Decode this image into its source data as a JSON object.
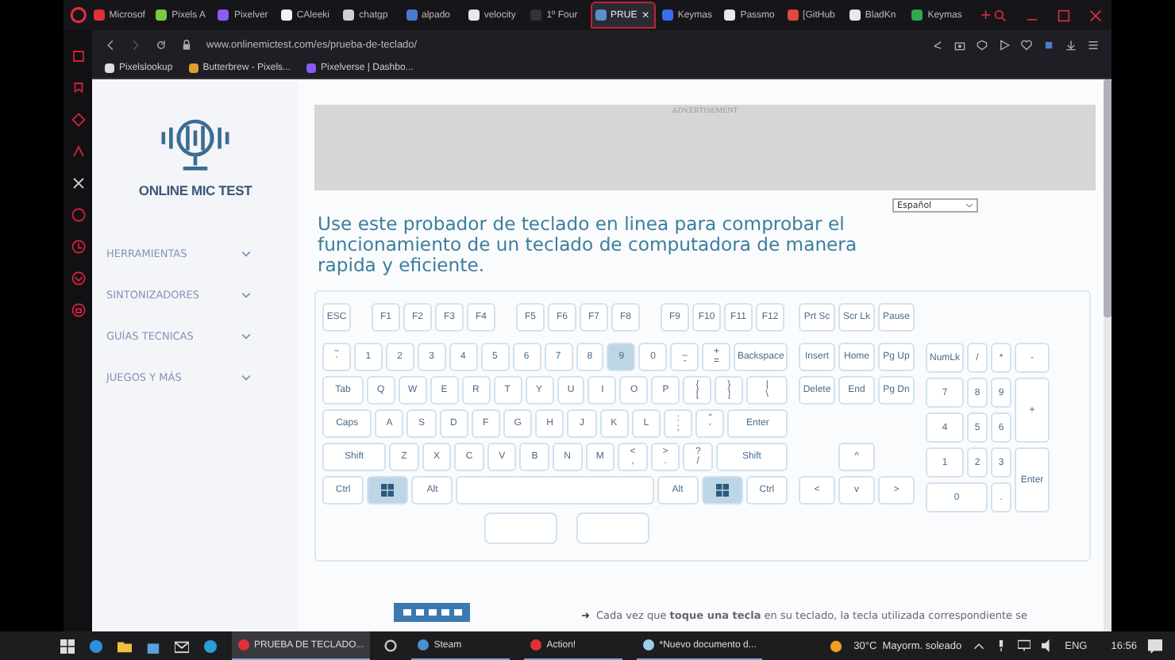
{
  "browser": {
    "tabs": [
      {
        "label": "Microsof",
        "selected": false,
        "color": "#e0303a"
      },
      {
        "label": "Pixels A",
        "selected": false,
        "color": "#7ac943"
      },
      {
        "label": "Pixelver",
        "selected": false,
        "color": "#8a5cf6"
      },
      {
        "label": "CAleeki",
        "selected": false,
        "color": "#f2f2f2"
      },
      {
        "label": "chatgp",
        "selected": false,
        "color": "#cfcfcf"
      },
      {
        "label": "alpado",
        "selected": false,
        "color": "#4a7bd0"
      },
      {
        "label": "velocity",
        "selected": false,
        "color": "#e8e8e8"
      },
      {
        "label": "1º Four",
        "selected": false,
        "color": "#333333"
      },
      {
        "label": "PRUE",
        "selected": true,
        "color": "#5a8fc8"
      },
      {
        "label": "Keymas",
        "selected": false,
        "color": "#3c6df0"
      },
      {
        "label": "Passmo",
        "selected": false,
        "color": "#e8e8e8"
      },
      {
        "label": "[GitHub",
        "selected": false,
        "color": "#e04a3a"
      },
      {
        "label": "BladKn",
        "selected": false,
        "color": "#e8e8e8"
      },
      {
        "label": "Keymas",
        "selected": false,
        "color": "#2fa84f"
      }
    ],
    "tab_close": "×",
    "new_tab": "+",
    "url": "www.onlinemictest.com/es/prueba-de-teclado/",
    "bookmarks": [
      {
        "label": "Pixelslookup",
        "color": "#dddddd"
      },
      {
        "label": "Butterbrew - Pixels...",
        "color": "#e0a030"
      },
      {
        "label": "Pixelverse | Dashbo...",
        "color": "#8a5cf6"
      }
    ]
  },
  "site": {
    "logo_text": "ONLINE MIC TEST",
    "nav": [
      {
        "label": "HERRAMIENTAS",
        "expanded": false
      },
      {
        "label": "SINTONIZADORES",
        "expanded": false
      },
      {
        "label": "GUÍAS TECNICAS",
        "expanded": false
      },
      {
        "label": "JUEGOS Y MÁS",
        "expanded": false
      }
    ],
    "advertisement": "ADVERTISEMENT",
    "language": "Español",
    "heading": "Use este probador de teclado en linea para comprobar el funcionamiento de un teclado de computadora de manera rapida y eficiente.",
    "footer_arrow": "➜",
    "footer_text": "Cada vez que **toque una tecla** en su teclado, la tecla utilizada correspondiente se"
  },
  "keyboard": {
    "function_row": [
      [
        {
          "label": "ESC",
          "pressed": false
        }
      ],
      [
        {
          "label": "F1",
          "pressed": false
        },
        {
          "label": "F2",
          "pressed": false
        },
        {
          "label": "F3",
          "pressed": false
        },
        {
          "label": "F4",
          "pressed": false
        }
      ],
      [
        {
          "label": "F5",
          "pressed": false
        },
        {
          "label": "F6",
          "pressed": false
        },
        {
          "label": "F7",
          "pressed": false
        },
        {
          "label": "F8",
          "pressed": false
        }
      ],
      [
        {
          "label": "F9",
          "pressed": false
        },
        {
          "label": "F10",
          "pressed": false
        },
        {
          "label": "F11",
          "pressed": false
        },
        {
          "label": "F12",
          "pressed": false
        }
      ]
    ],
    "key_rows": [
      {
        "keys": [
          {
            "label": "~\n`",
            "kind": "key",
            "pressed": false
          },
          {
            "label": "1",
            "kind": "key",
            "pressed": false
          },
          {
            "label": "2",
            "kind": "key",
            "pressed": false
          },
          {
            "label": "3",
            "kind": "key",
            "pressed": false
          },
          {
            "label": "4",
            "kind": "key",
            "pressed": false
          },
          {
            "label": "5",
            "kind": "key",
            "pressed": false
          },
          {
            "label": "6",
            "kind": "key",
            "pressed": false
          },
          {
            "label": "7",
            "kind": "key",
            "pressed": false
          },
          {
            "label": "8",
            "kind": "key",
            "pressed": false
          },
          {
            "label": "9",
            "kind": "key",
            "pressed": true
          },
          {
            "label": "0",
            "kind": "key",
            "pressed": false
          },
          {
            "label": "_\n-",
            "kind": "key",
            "pressed": false
          },
          {
            "label": "+\n=",
            "kind": "key",
            "pressed": false
          },
          {
            "label": "Backspace",
            "kind": "backspace",
            "pressed": false
          }
        ]
      },
      {
        "keys": [
          {
            "label": "Tab",
            "kind": "tab",
            "pressed": false
          },
          {
            "label": "Q",
            "kind": "key",
            "pressed": false
          },
          {
            "label": "W",
            "kind": "key",
            "pressed": false
          },
          {
            "label": "E",
            "kind": "key",
            "pressed": false
          },
          {
            "label": "R",
            "kind": "key",
            "pressed": false
          },
          {
            "label": "T",
            "kind": "key",
            "pressed": false
          },
          {
            "label": "Y",
            "kind": "key",
            "pressed": false
          },
          {
            "label": "U",
            "kind": "key",
            "pressed": false
          },
          {
            "label": "I",
            "kind": "key",
            "pressed": false
          },
          {
            "label": "O",
            "kind": "key",
            "pressed": false
          },
          {
            "label": "P",
            "kind": "key",
            "pressed": false
          },
          {
            "label": "{\n[",
            "kind": "key",
            "pressed": false
          },
          {
            "label": "}\n]",
            "kind": "key",
            "pressed": false
          },
          {
            "label": "|\n\\",
            "kind": "tab",
            "pressed": false
          }
        ]
      },
      {
        "keys": [
          {
            "label": "Caps",
            "kind": "caps",
            "pressed": false
          },
          {
            "label": "A",
            "kind": "key",
            "pressed": false
          },
          {
            "label": "S",
            "kind": "key",
            "pressed": false
          },
          {
            "label": "D",
            "kind": "key",
            "pressed": false
          },
          {
            "label": "F",
            "kind": "key",
            "pressed": false
          },
          {
            "label": "G",
            "kind": "key",
            "pressed": false
          },
          {
            "label": "H",
            "kind": "key",
            "pressed": false
          },
          {
            "label": "J",
            "kind": "key",
            "pressed": false
          },
          {
            "label": "K",
            "kind": "key",
            "pressed": false
          },
          {
            "label": "L",
            "kind": "key",
            "pressed": false
          },
          {
            "label": ":\n;",
            "kind": "key",
            "pressed": false
          },
          {
            "label": "\"\n'",
            "kind": "key",
            "pressed": false
          },
          {
            "label": "Enter",
            "kind": "enter",
            "pressed": false
          }
        ]
      },
      {
        "keys": [
          {
            "label": "Shift",
            "kind": "shift",
            "pressed": false
          },
          {
            "label": "Z",
            "kind": "key",
            "pressed": false
          },
          {
            "label": "X",
            "kind": "key",
            "pressed": false
          },
          {
            "label": "C",
            "kind": "key",
            "pressed": false
          },
          {
            "label": "V",
            "kind": "key",
            "pressed": false
          },
          {
            "label": "B",
            "kind": "key",
            "pressed": false
          },
          {
            "label": "N",
            "kind": "key",
            "pressed": false
          },
          {
            "label": "M",
            "kind": "key",
            "pressed": false
          },
          {
            "label": "<\n,",
            "kind": "key",
            "pressed": false
          },
          {
            "label": ">\n.",
            "kind": "key",
            "pressed": false
          },
          {
            "label": "?\n/",
            "kind": "key",
            "pressed": false
          },
          {
            "label": "Shift",
            "kind": "rshift",
            "pressed": false
          }
        ]
      },
      {
        "keys": [
          {
            "label": "Ctrl",
            "kind": "mod",
            "pressed": false
          },
          {
            "kind": "win",
            "pressed": true
          },
          {
            "label": "Alt",
            "kind": "mod",
            "pressed": false
          },
          {
            "kind": "space",
            "pressed": false
          },
          {
            "label": "Alt",
            "kind": "mod",
            "pressed": false
          },
          {
            "kind": "win",
            "pressed": true
          },
          {
            "label": "Ctrl",
            "kind": "mod",
            "pressed": false
          }
        ]
      }
    ],
    "mouse_buttons": [
      {
        "pressed": false
      },
      {
        "pressed": false
      }
    ],
    "system_keys": [
      {
        "label": "Prt Sc",
        "pressed": false
      },
      {
        "label": "Scr Lk",
        "pressed": false
      },
      {
        "label": "Pause",
        "pressed": false
      }
    ],
    "navigation": [
      [
        {
          "label": "Insert",
          "pressed": false
        },
        {
          "label": "Home",
          "pressed": false
        },
        {
          "label": "Pg Up",
          "pressed": false
        }
      ],
      [
        {
          "label": "Delete",
          "pressed": false
        },
        {
          "label": "End",
          "pressed": false
        },
        {
          "label": "Pg Dn",
          "pressed": false
        }
      ],
      [
        {
          "label": "^",
          "pressed": false
        }
      ],
      [
        {
          "label": "<",
          "pressed": false
        },
        {
          "label": "v",
          "pressed": false
        },
        {
          "label": ">",
          "pressed": false
        }
      ]
    ],
    "numpad": [
      {
        "label": "NumLk",
        "kind": "key",
        "pressed": false
      },
      {
        "label": "/",
        "kind": "key",
        "pressed": false
      },
      {
        "label": "*",
        "kind": "key",
        "pressed": false
      },
      {
        "label": "-",
        "kind": "key",
        "pressed": false
      },
      {
        "label": "7",
        "kind": "key",
        "pressed": false
      },
      {
        "label": "8",
        "kind": "key",
        "pressed": false
      },
      {
        "label": "9",
        "kind": "key",
        "pressed": false
      },
      {
        "label": "+",
        "kind": "tall",
        "pressed": false
      },
      {
        "label": "4",
        "kind": "key",
        "pressed": false
      },
      {
        "label": "5",
        "kind": "key",
        "pressed": false
      },
      {
        "label": "6",
        "kind": "key",
        "pressed": false
      },
      {
        "label": "1",
        "kind": "key",
        "pressed": false
      },
      {
        "label": "2",
        "kind": "key",
        "pressed": false
      },
      {
        "label": "3",
        "kind": "key",
        "pressed": false
      },
      {
        "label": "Enter",
        "kind": "tall",
        "pressed": false
      },
      {
        "label": "0",
        "kind": "wide",
        "pressed": false
      },
      {
        "label": ".",
        "kind": "key",
        "pressed": false
      }
    ]
  },
  "taskbar": {
    "apps": [
      {
        "label": "PRUEBA DE TECLADO...",
        "selected": true,
        "color": "#e0303a"
      },
      {
        "label": "Steam",
        "selected": false,
        "color": "#4a90d0"
      },
      {
        "label": "Action!",
        "selected": false,
        "color": "#e0303a"
      },
      {
        "label": "*Nuevo documento d...",
        "selected": false,
        "color": "#9ad0e8"
      }
    ],
    "weather": "30°C  Mayorm. soleado",
    "language": "ENG",
    "time": "16:56"
  }
}
